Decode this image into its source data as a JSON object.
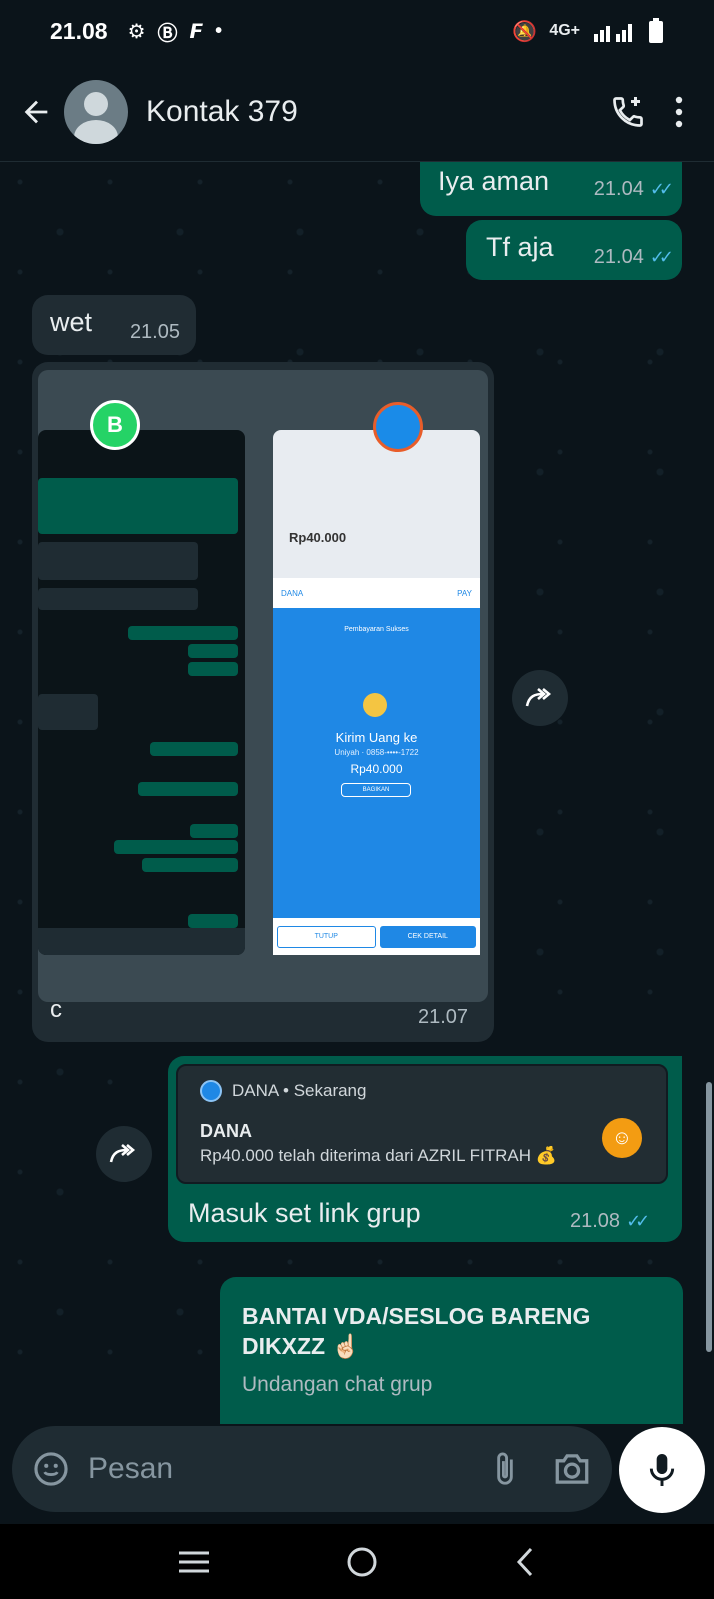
{
  "status_bar": {
    "time": "21.08",
    "network": "4G+"
  },
  "header": {
    "contact_name": "Kontak 379"
  },
  "messages": [
    {
      "text": "Iya aman",
      "time": "21.04",
      "direction": "out"
    },
    {
      "text": "Tf aja",
      "time": "21.04",
      "direction": "out"
    },
    {
      "text": "wet",
      "time": "21.05",
      "direction": "in"
    },
    {
      "caption": "c",
      "time": "21.07",
      "direction": "in",
      "type": "image"
    },
    {
      "text": "Masuk set link grup",
      "time": "21.08",
      "direction": "out"
    }
  ],
  "image_content": {
    "right_title": "Kirim Uang ke",
    "right_amount": "Rp40.000",
    "right_status": "Pembayaran Sukses",
    "right_btn_close": "TUTUP",
    "right_btn_detail": "CEK DETAIL",
    "right_share": "BAGIKAN",
    "right_header_amount": "Rp40.000"
  },
  "quoted_notification": {
    "app_line": "DANA • Sekarang",
    "title": "DANA",
    "body": "Rp40.000 telah diterima dari AZRIL FITRAH 💰"
  },
  "group_invite": {
    "title": "BANTAI VDA/SESLOG BARENG DIKXZZ ☝🏻",
    "subtitle": "Undangan chat grup"
  },
  "composer": {
    "placeholder": "Pesan"
  },
  "colors": {
    "outgoing": "#005c4b",
    "incoming": "#202c33",
    "background": "#0b141a",
    "read_ticks": "#53bdeb"
  }
}
